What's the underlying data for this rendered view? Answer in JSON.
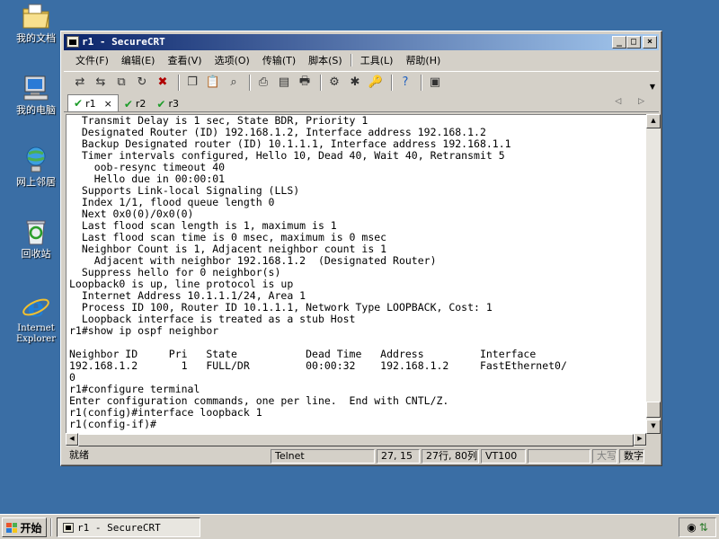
{
  "desktop": {
    "icons": [
      {
        "label": "我的文档",
        "icon": "my-documents-icon"
      },
      {
        "label": "我的电脑",
        "icon": "my-computer-icon"
      },
      {
        "label": "网上邻居",
        "icon": "network-places-icon"
      },
      {
        "label": "回收站",
        "icon": "recycle-bin-icon"
      },
      {
        "label": "Internet Explorer",
        "icon": "internet-explorer-icon"
      }
    ]
  },
  "window": {
    "title": "r1 - SecureCRT",
    "controls": {
      "minimize": "_",
      "maximize": "□",
      "close": "×"
    }
  },
  "menu": [
    "文件(F)",
    "编辑(E)",
    "查看(V)",
    "选项(O)",
    "传输(T)",
    "脚本(S)",
    "工具(L)",
    "帮助(H)"
  ],
  "tabs": [
    {
      "label": "r1",
      "active": true,
      "close": "×"
    },
    {
      "label": "r2",
      "active": false
    },
    {
      "label": "r3",
      "active": false
    }
  ],
  "tab_nav": "◁ ▷",
  "terminal": {
    "text": "  Transmit Delay is 1 sec, State BDR, Priority 1\n  Designated Router (ID) 192.168.1.2, Interface address 192.168.1.2\n  Backup Designated router (ID) 10.1.1.1, Interface address 192.168.1.1\n  Timer intervals configured, Hello 10, Dead 40, Wait 40, Retransmit 5\n    oob-resync timeout 40\n    Hello due in 00:00:01\n  Supports Link-local Signaling (LLS)\n  Index 1/1, flood queue length 0\n  Next 0x0(0)/0x0(0)\n  Last flood scan length is 1, maximum is 1\n  Last flood scan time is 0 msec, maximum is 0 msec\n  Neighbor Count is 1, Adjacent neighbor count is 1\n    Adjacent with neighbor 192.168.1.2  (Designated Router)\n  Suppress hello for 0 neighbor(s)\nLoopback0 is up, line protocol is up\n  Internet Address 10.1.1.1/24, Area 1\n  Process ID 100, Router ID 10.1.1.1, Network Type LOOPBACK, Cost: 1\n  Loopback interface is treated as a stub Host\nr1#show ip ospf neighbor\n\nNeighbor ID     Pri   State           Dead Time   Address         Interface\n192.168.1.2       1   FULL/DR         00:00:32    192.168.1.2     FastEthernet0/\n0\nr1#configure terminal\nEnter configuration commands, one per line.  End with CNTL/Z.\nr1(config)#interface loopback 1\nr1(config-if)#"
  },
  "status": {
    "ready": "就绪",
    "protocol": "Telnet",
    "cursor": "27, 15",
    "size": "27行, 80列",
    "emulation": "VT100",
    "blank": "",
    "caps": "大写",
    "num": "数字"
  },
  "taskbar": {
    "start_label": "开始",
    "task_label": "r1 - SecureCRT"
  },
  "colors": {
    "desktop": "#3a6ea5",
    "titlebar_start": "#0a246a",
    "titlebar_end": "#a6caf0",
    "chrome": "#d4d0c8",
    "tab_check": "#1e9c2a"
  }
}
